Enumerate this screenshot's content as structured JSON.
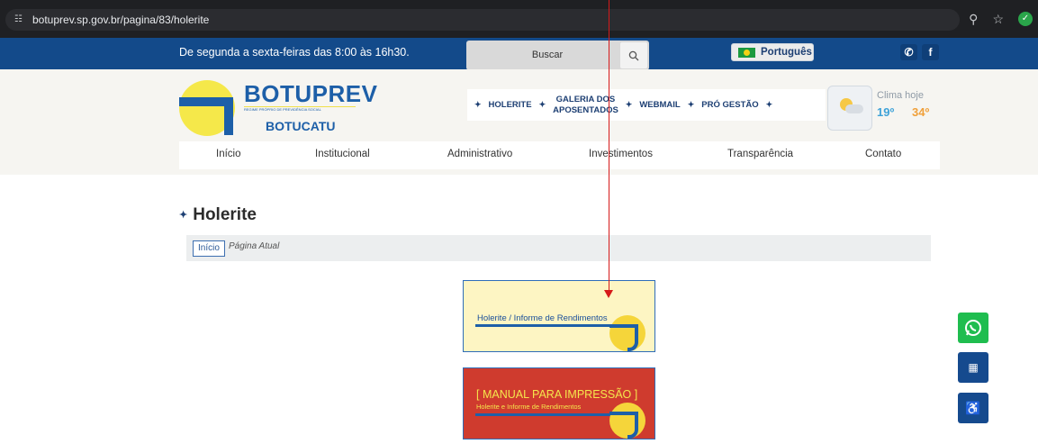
{
  "browser": {
    "url": "botuprev.sp.gov.br/pagina/83/holerite",
    "site_icon": "tune-icon",
    "right_icons": [
      "zoom-icon",
      "bookmark-star-icon",
      "extension-icon"
    ]
  },
  "infobar": {
    "hours": "De segunda a sexta-feiras das 8:00 às 16h30.",
    "search_placeholder": "Buscar",
    "language": "Português",
    "social": [
      "whatsapp-icon",
      "facebook-icon"
    ]
  },
  "logo": {
    "name": "BOTUPREV",
    "tagline": "REGIME PRÓPRIO DE PREVIDÊNCIA SOCIAL",
    "city": "BOTUCATU"
  },
  "quicklinks": {
    "holerite": "HOLERITE",
    "galeria_line1": "GALERIA DOS",
    "galeria_line2": "APOSENTADOS",
    "webmail": "WEBMAIL",
    "pro_gestao": "PRÓ GESTÃO"
  },
  "weather": {
    "label": "Clima hoje",
    "min": "19º",
    "max": "34º"
  },
  "nav": {
    "items": [
      "Início",
      "Institucional",
      "Administrativo",
      "Investimentos",
      "Transparência",
      "Contato"
    ]
  },
  "page": {
    "title": "Holerite",
    "breadcrumb_home": "Início",
    "breadcrumb_current": "Página Atual"
  },
  "banners": {
    "holerite_text": "Holerite / Informe de Rendimentos",
    "manual_title": "[ MANUAL PARA IMPRESSÃO ]",
    "manual_subtitle": "Holerite e Informe de Rendimentos"
  },
  "colors": {
    "brand_blue": "#134a8a",
    "brand_yellow": "#f5e84a",
    "manual_red": "#cf3b2e",
    "annotation_red": "#d61a1a"
  }
}
